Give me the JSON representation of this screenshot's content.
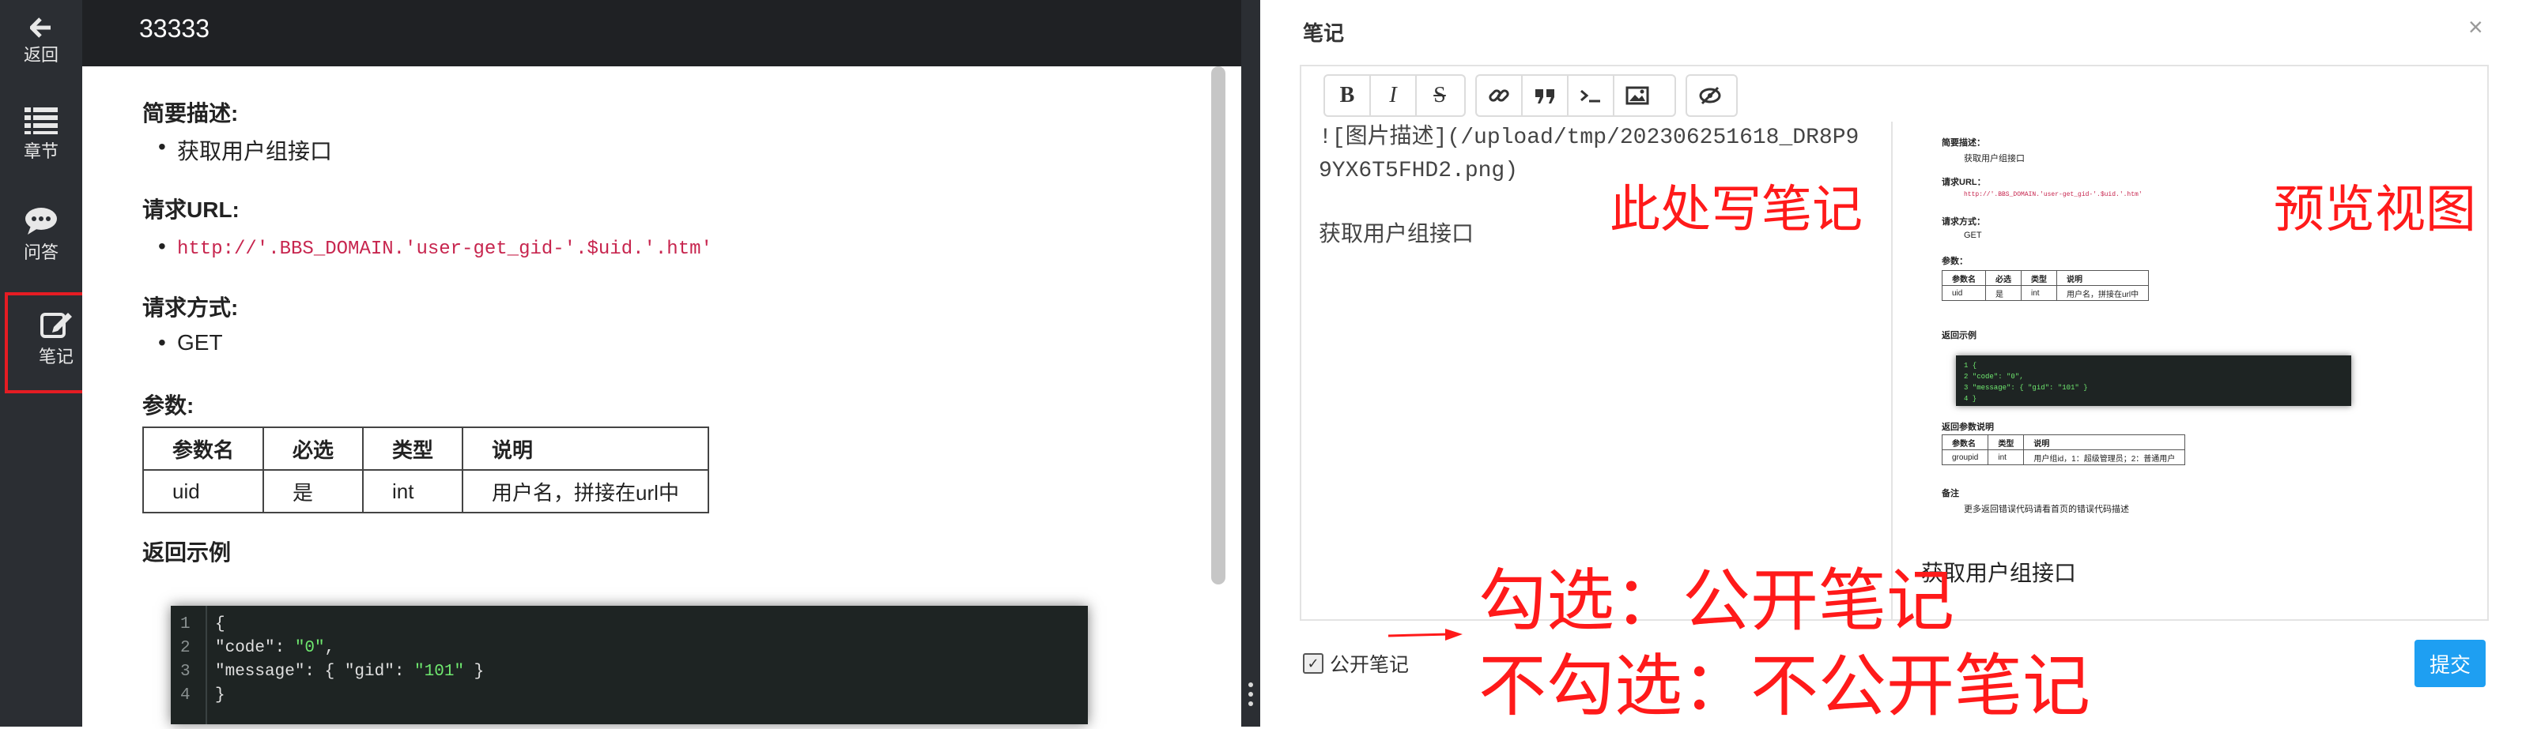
{
  "sidebar": {
    "items": [
      {
        "label": "返回",
        "icon": "arrow-left-icon"
      },
      {
        "label": "章节",
        "icon": "list-icon"
      },
      {
        "label": "问答",
        "icon": "chat-bubble-icon"
      },
      {
        "label": "笔记",
        "icon": "edit-icon"
      }
    ]
  },
  "header": {
    "title": "33333"
  },
  "doc": {
    "summary_heading": "简要描述:",
    "summary_item": "获取用户组接口",
    "url_heading": "请求URL:",
    "url_item": "http://'.BBS_DOMAIN.'user-get_gid-'.$uid.'.htm'",
    "method_heading": "请求方式:",
    "method_item": "GET",
    "params_heading": "参数:",
    "params_headers": [
      "参数名",
      "必选",
      "类型",
      "说明"
    ],
    "params_row": [
      "uid",
      "是",
      "int",
      "用户名，拼接在url中"
    ],
    "example_heading": "返回示例",
    "code_lines": [
      {
        "n": "1",
        "text": "{"
      },
      {
        "n": "2",
        "key": "\"code\": ",
        "val": "\"0\"",
        "tail": ","
      },
      {
        "n": "3",
        "key": "\"message\": { \"gid\": ",
        "val": "\"101\"",
        "tail": " }"
      },
      {
        "n": "4",
        "text": "}"
      }
    ]
  },
  "panel": {
    "title": "笔记",
    "close": "×",
    "toolbar": [
      "B",
      "I",
      "S"
    ],
    "markdown_text": "![图片描述](/upload/tmp/202306251618_DR8P99YX6T5FHD2.png)",
    "markdown_line2": "获取用户组接口",
    "preview": {
      "h1": "简要描述：",
      "i1": "获取用户组接口",
      "h2": "请求URL：",
      "i2": "http://'.BBS_DOMAIN.'user-get_gid-'.$uid.'.htm'",
      "h3": "请求方式：",
      "i3": "GET",
      "h4": "参数：",
      "t1_headers": [
        "参数名",
        "必选",
        "类型",
        "说明"
      ],
      "t1_row": [
        "uid",
        "是",
        "int",
        "用户名，拼接在url中"
      ],
      "h5": "返回示例",
      "code": [
        "1  {",
        "2    \"code\": \"0\",",
        "3    \"message\": { \"gid\": \"101\" }",
        "4  }"
      ],
      "h6": "返回参数说明",
      "t2_headers": [
        "参数名",
        "类型",
        "说明"
      ],
      "t2_row": [
        "groupid",
        "int",
        "用户组id，1：超级管理员；2：普通用户"
      ],
      "h7": "备注",
      "i7": "更多返回错误代码请看首页的错误代码描述",
      "last_line": "获取用户组接口"
    },
    "public_checkbox_label": "公开笔记",
    "submit_label": "提交"
  },
  "annotations": {
    "write_here": "此处写笔记",
    "preview_view": "预览视图",
    "checked": "勾选：公开笔记",
    "unchecked": "不勾选：不公开笔记"
  },
  "colors": {
    "annotation": "#ff1a1a",
    "submit": "#1e9ff2",
    "sidebar": "#2b2e33",
    "code_bg": "#1e2423"
  }
}
